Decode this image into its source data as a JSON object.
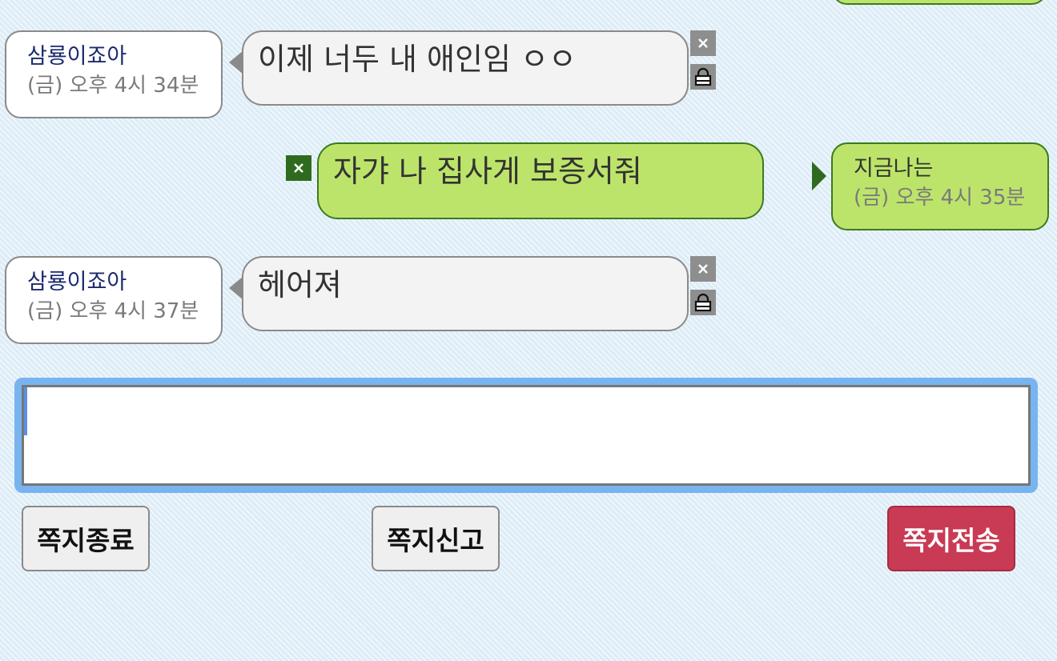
{
  "messages": [
    {
      "side": "received",
      "sender": "삼룡이죠아",
      "time": "(금) 오후 4시 34분",
      "text": "이제 너두 내 애인임 ㅇㅇ",
      "actions": [
        "close-icon",
        "lock-icon"
      ]
    },
    {
      "side": "sent",
      "sender": "지금나는",
      "time": "(금) 오후 4시 35분",
      "text": "자갸 나 집사게 보증서줘",
      "actions": [
        "close-icon"
      ]
    },
    {
      "side": "received",
      "sender": "삼룡이죠아",
      "time": "(금) 오후 4시 37분",
      "text": "헤어져",
      "actions": [
        "close-icon",
        "lock-icon"
      ]
    }
  ],
  "compose": {
    "value": "",
    "placeholder": ""
  },
  "buttons": {
    "end_label": "쪽지종료",
    "report_label": "쪽지신고",
    "send_label": "쪽지전송"
  },
  "colors": {
    "background": "#dcecf7",
    "received_bubble": "#f3f3f3",
    "sent_bubble": "#bde46a",
    "sent_border": "#3a7a22",
    "compose_focus": "#78b4ef",
    "send_button": "#c93a54"
  }
}
